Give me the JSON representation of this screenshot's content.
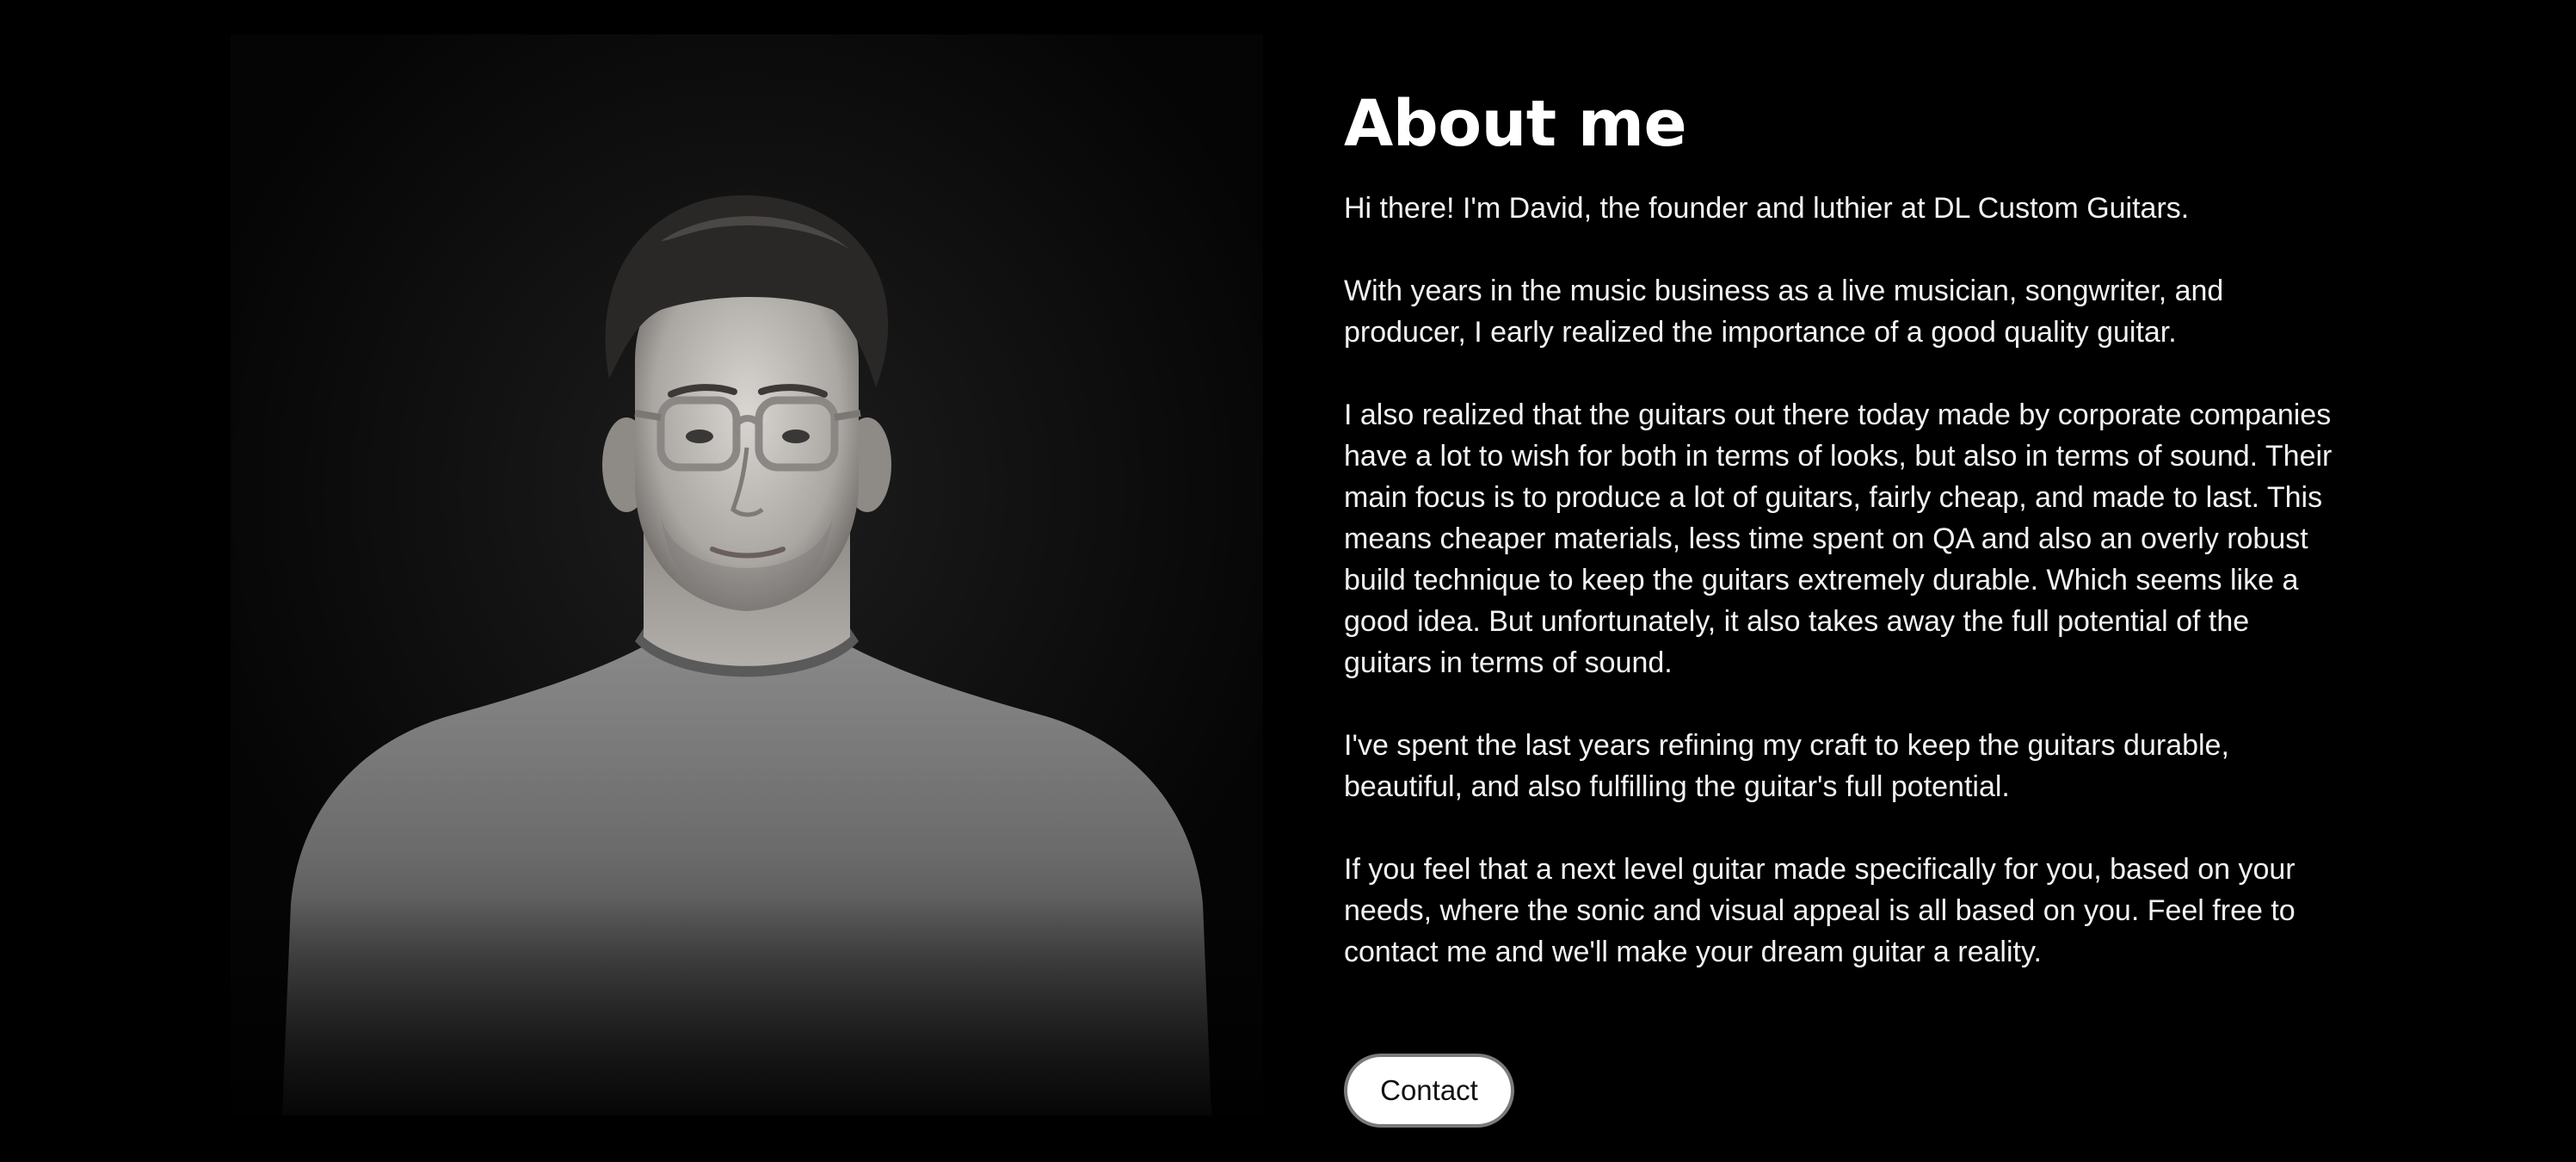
{
  "about": {
    "title": "About me",
    "paragraphs": [
      "Hi there! I'm David, the founder and luthier at DL Custom Guitars.",
      "With years in the music business as a live musician, songwriter, and producer, I early realized the importance of a good quality guitar.",
      "I also realized that the guitars out there today made by corporate companies have a lot to wish for both in terms of looks, but also in terms of sound. Their main focus is to produce a lot of guitars, fairly cheap, and made to last. This means cheaper materials, less time spent on QA and also an overly robust build technique to keep the guitars extremely durable. Which seems like a good idea. But unfortunately, it also takes away the full potential of the guitars in terms of sound.",
      "I've spent the last years refining my craft to keep the guitars durable, beautiful, and also fulfilling the guitar's full potential.",
      "If you feel that a next level guitar made specifically for you, based on your needs, where the sonic and visual appeal is all based on you. Feel free to contact me and we'll make your dream guitar a reality."
    ],
    "contact_label": "Contact"
  },
  "colors": {
    "background": "#000000",
    "text": "#ffffff",
    "button_background": "#ffffff",
    "button_text": "#111111",
    "button_border": "#7a7a7a"
  }
}
